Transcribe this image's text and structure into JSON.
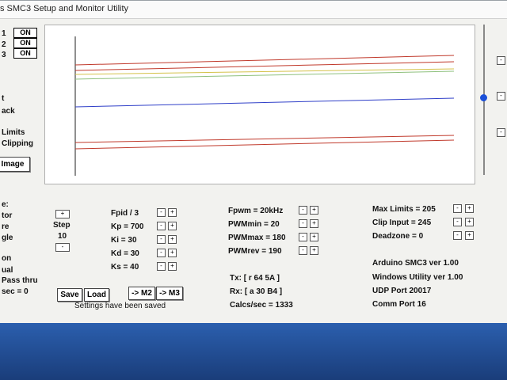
{
  "window": {
    "title": "s SMC3 Setup and Monitor Utility"
  },
  "motors": [
    {
      "num": "1",
      "state": "ON"
    },
    {
      "num": "2",
      "state": "ON"
    },
    {
      "num": "3",
      "state": "ON"
    }
  ],
  "left_partial": {
    "t": "t",
    "back": "ack",
    "limits": "Limits",
    "clipping": "Clipping",
    "image_button": "Image",
    "e": "e:",
    "tor": "tor",
    "re": "re",
    "gle": "gle",
    "on": "on",
    "ual": "ual",
    "pass_thru": "Pass thru",
    "sec": "sec = 0"
  },
  "step": {
    "plus": "+",
    "label": "Step",
    "value": "10",
    "minus": "-"
  },
  "pid": [
    {
      "label": "Fpid / 3"
    },
    {
      "label": "Kp = 700"
    },
    {
      "label": "Ki = 30"
    },
    {
      "label": "Kd = 30"
    },
    {
      "label": "Ks = 40"
    }
  ],
  "pwm": [
    {
      "label": "Fpwm = 20kHz"
    },
    {
      "label": "PWMmin = 20"
    },
    {
      "label": "PWMmax = 180"
    },
    {
      "label": "PWMrev = 190"
    }
  ],
  "limits": [
    {
      "label": "Max Limits = 205"
    },
    {
      "label": "Clip Input = 245"
    },
    {
      "label": "Deadzone = 0"
    }
  ],
  "comm": {
    "tx": "Tx: [ r 64 5A ]",
    "rx": "Rx: [ a 30 B4 ]",
    "calcs": "Calcs/sec = 1333"
  },
  "info": {
    "arduino": "Arduino SMC3 ver 1.00",
    "windows": "Windows Utility ver 1.00",
    "udp": "UDP Port 20017",
    "port": "Comm Port 16"
  },
  "buttons": {
    "save": "Save",
    "load": "Load",
    "m2": "-> M2",
    "m3": "-> M3"
  },
  "status": "Settings have been saved",
  "spin_labels": {
    "minus": "-",
    "plus": "+"
  },
  "right_minus": "-",
  "colors": {
    "red": "#c0392b",
    "yellow": "#d4c24a",
    "green": "#8ec07c",
    "blue": "#2f3fc8"
  }
}
